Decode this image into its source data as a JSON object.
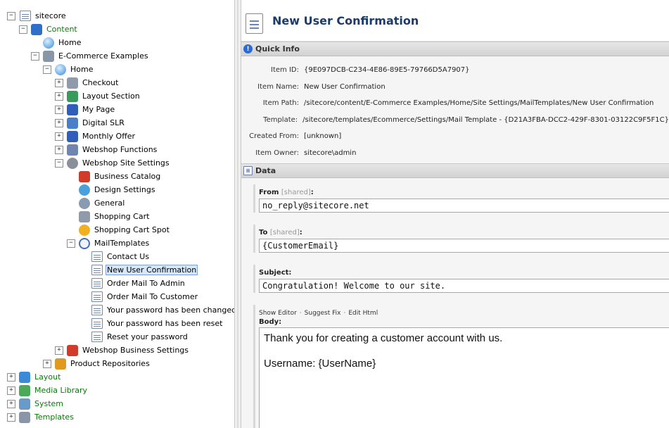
{
  "tree": [
    {
      "label": "sitecore",
      "icon": "page-icon",
      "indent": 0,
      "toggle": "minus",
      "green": false
    },
    {
      "label": "Content",
      "icon": "content-icon",
      "indent": 1,
      "toggle": "minus",
      "green": true
    },
    {
      "label": "Home",
      "icon": "home-icon",
      "indent": 2,
      "toggle": "none",
      "green": false
    },
    {
      "label": "E-Commerce Examples",
      "icon": "folder-icon",
      "indent": 2,
      "toggle": "minus",
      "green": false
    },
    {
      "label": "Home",
      "icon": "home-icon",
      "indent": 3,
      "toggle": "minus",
      "green": false
    },
    {
      "label": "Checkout",
      "icon": "cart-icon",
      "indent": 4,
      "toggle": "plus",
      "green": false
    },
    {
      "label": "Layout Section",
      "icon": "layout-section-icon",
      "indent": 4,
      "toggle": "plus",
      "green": false
    },
    {
      "label": "My Page",
      "icon": "grid-icon",
      "indent": 4,
      "toggle": "plus",
      "green": false
    },
    {
      "label": "Digital SLR",
      "icon": "database-icon",
      "indent": 4,
      "toggle": "plus",
      "green": false
    },
    {
      "label": "Monthly Offer",
      "icon": "grid-icon",
      "indent": 4,
      "toggle": "plus",
      "green": false
    },
    {
      "label": "Webshop Functions",
      "icon": "functions-icon",
      "indent": 4,
      "toggle": "plus",
      "green": false
    },
    {
      "label": "Webshop Site Settings",
      "icon": "settings-gear-icon",
      "indent": 4,
      "toggle": "minus",
      "green": false
    },
    {
      "label": "Business Catalog",
      "icon": "catalog-icon",
      "indent": 5,
      "toggle": "none",
      "green": false
    },
    {
      "label": "Design Settings",
      "icon": "palette-icon",
      "indent": 5,
      "toggle": "none",
      "green": false
    },
    {
      "label": "General",
      "icon": "gears-icon",
      "indent": 5,
      "toggle": "none",
      "green": false
    },
    {
      "label": "Shopping Cart",
      "icon": "cart-icon",
      "indent": 5,
      "toggle": "none",
      "green": false
    },
    {
      "label": "Shopping Cart Spot",
      "icon": "cart-spot-icon",
      "indent": 5,
      "toggle": "none",
      "green": false
    },
    {
      "label": "MailTemplates",
      "icon": "at-sign-icon",
      "indent": 5,
      "toggle": "minus",
      "green": false
    },
    {
      "label": "Contact Us",
      "icon": "page-icon",
      "indent": 6,
      "toggle": "none",
      "green": false
    },
    {
      "label": "New User Confirmation",
      "icon": "page-icon",
      "indent": 6,
      "toggle": "none",
      "green": false,
      "selected": true
    },
    {
      "label": "Order Mail To Admin",
      "icon": "page-icon",
      "indent": 6,
      "toggle": "none",
      "green": false
    },
    {
      "label": "Order Mail To Customer",
      "icon": "page-icon",
      "indent": 6,
      "toggle": "none",
      "green": false
    },
    {
      "label": "Your password has been changed",
      "icon": "page-icon",
      "indent": 6,
      "toggle": "none",
      "green": false
    },
    {
      "label": "Your password has been reset",
      "icon": "page-icon",
      "indent": 6,
      "toggle": "none",
      "green": false
    },
    {
      "label": "Reset your password",
      "icon": "page-icon",
      "indent": 6,
      "toggle": "none",
      "green": false
    },
    {
      "label": "Webshop Business Settings",
      "icon": "catalog-icon",
      "indent": 4,
      "toggle": "plus",
      "green": false
    },
    {
      "label": "Product Repositories",
      "icon": "box-icon",
      "indent": 3,
      "toggle": "plus",
      "green": false
    },
    {
      "label": "Layout",
      "icon": "layout-icon",
      "indent": 0,
      "toggle": "plus",
      "green": true
    },
    {
      "label": "Media Library",
      "icon": "media-library-icon",
      "indent": 0,
      "toggle": "plus",
      "green": true
    },
    {
      "label": "System",
      "icon": "system-icon",
      "indent": 0,
      "toggle": "plus",
      "green": true
    },
    {
      "label": "Templates",
      "icon": "templates-icon",
      "indent": 0,
      "toggle": "plus",
      "green": true
    }
  ],
  "icon_colors": {
    "page-icon": "#ffffff",
    "content-icon": "#2f6fc9",
    "home-icon": "#3a8ad8",
    "folder-icon": "#8a96a8",
    "cart-icon": "#8f9bab",
    "layout-section-icon": "#3a9a5a",
    "grid-icon": "#2f5fb8",
    "database-icon": "#4a7ec8",
    "functions-icon": "#6f86b0",
    "settings-gear-icon": "#8a8f99",
    "catalog-icon": "#d23a2a",
    "palette-icon": "#4aa0d8",
    "gears-icon": "#8a9ab0",
    "cart-spot-icon": "#f0b020",
    "at-sign-icon": "#4a6fb0",
    "box-icon": "#e09a20",
    "layout-icon": "#3a8ad8",
    "media-library-icon": "#4aaa5a",
    "system-icon": "#6a9ac8",
    "templates-icon": "#8a96a8"
  },
  "header": {
    "title": "New User Confirmation"
  },
  "quick_info": {
    "title": "Quick Info",
    "rows": [
      {
        "key": "Item ID:",
        "value": "{9E097DCB-C234-4E86-89E5-79766D5A7907}"
      },
      {
        "key": "Item Name:",
        "value": "New User Confirmation"
      },
      {
        "key": "Item Path:",
        "value": "/sitecore/content/E-Commerce Examples/Home/Site Settings/MailTemplates/New User Confirmation"
      },
      {
        "key": "Template:",
        "value": "/sitecore/templates/Ecommerce/Settings/Mail Template - {D21A3FBA-DCC2-429F-8301-03122C9F5F1C}"
      },
      {
        "key": "Created From:",
        "value": "[unknown]"
      },
      {
        "key": "Item Owner:",
        "value": "sitecore\\admin"
      }
    ]
  },
  "data_section": {
    "title": "Data",
    "from": {
      "label": "From",
      "shared": "[shared]",
      "colon": ":",
      "value": "no_reply@sitecore.net"
    },
    "to": {
      "label": "To",
      "shared": "[shared]",
      "colon": ":",
      "value": "{CustomerEmail}"
    },
    "subject": {
      "label": "Subject:",
      "value": "Congratulation! Welcome to our site."
    },
    "body": {
      "links": {
        "show_editor": "Show Editor",
        "suggest_fix": "Suggest Fix",
        "edit_html": "Edit Html",
        "separator": "·"
      },
      "label": "Body:",
      "line1": "Thank you for creating a customer account with us.",
      "line2": "Username: {UserName}"
    }
  }
}
